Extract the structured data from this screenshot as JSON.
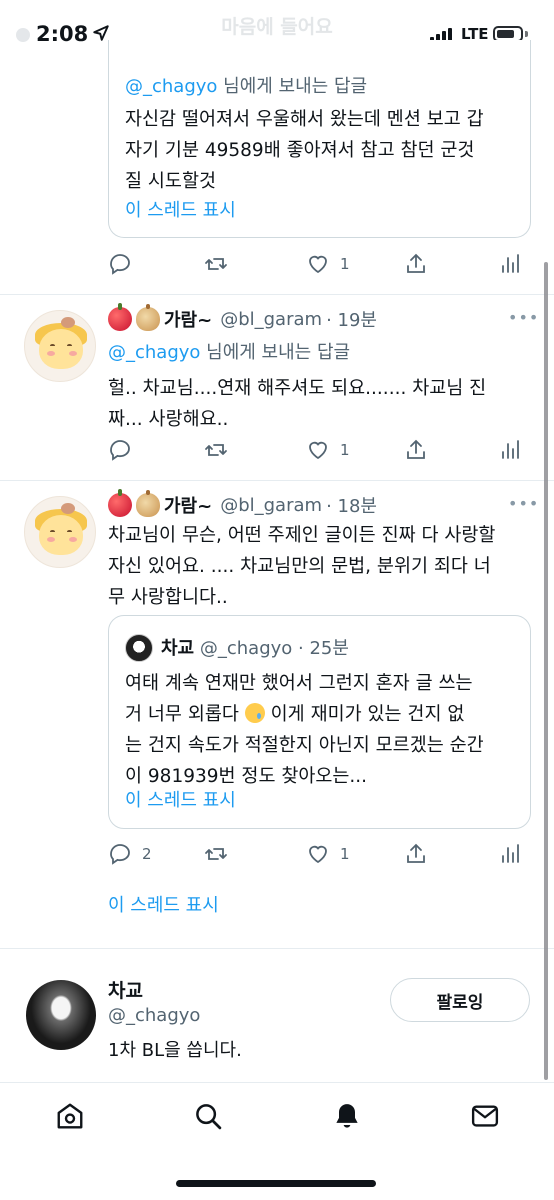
{
  "status_bar": {
    "time": "2:08",
    "network": "LTE",
    "ghost_title": "마음에 들어요",
    "ghost_subtitle": ""
  },
  "tweets": [
    {
      "reply_to_prefix": "@_chagyo",
      "reply_to_suffix": " 님에게 보내는 답글",
      "text_lines": [
        "자신감 떨어져서 우울해서 왔는데 멘션 보고 갑",
        "자기 기분 49589배 좋아져서 참고 참던 군것",
        "질 시도할것"
      ],
      "show_thread": "이 스레드 표시",
      "actions": {
        "reply": "",
        "retweet": "",
        "like": "1"
      }
    },
    {
      "display_name": "가람~",
      "handle": "@bl_garam",
      "time": "· 19분",
      "reply_to_prefix": "@_chagyo",
      "reply_to_suffix": " 님에게 보내는 답글",
      "text_lines": [
        "헐.. 차교님....연재 해주셔도 되요....... 차교님 진",
        "짜... 사랑해요.."
      ],
      "actions": {
        "reply": "",
        "retweet": "",
        "like": "1"
      }
    },
    {
      "display_name": "가람~",
      "handle": "@bl_garam",
      "time": "· 18분",
      "text_lines": [
        "차교님이 무슨, 어떤 주제인 글이든 진짜 다 사랑할",
        "자신 있어요. .... 차교님만의 문법, 분위기 죄다 너",
        "무 사랑합니다.."
      ],
      "quote": {
        "name": "차교",
        "handle": "@_chagyo",
        "time": "· 25분",
        "text_line1": "여태 계속 연재만 했어서 그런지 혼자 글 쓰는",
        "text_line2a": "거 너무 외롭다 ",
        "text_line2b": " 이게 재미가 있는 건지 없",
        "text_line3": "는 건지 속도가 적절한지 아닌지 모르겠는 순간",
        "text_line4": "이 981939번 정도 찾아오는...",
        "show_thread": "이 스레드 표시"
      },
      "actions": {
        "reply": "2",
        "retweet": "",
        "like": "1"
      },
      "show_thread": "이 스레드 표시"
    }
  ],
  "profile": {
    "name": "차교",
    "handle": "@_chagyo",
    "bio": "1차 BL을 씁니다.",
    "follow_label": "팔로잉"
  },
  "tabbar": {
    "items": [
      "home-icon",
      "search-icon",
      "notifications-icon",
      "messages-icon"
    ],
    "active": "notifications-icon"
  },
  "colors": {
    "accent": "#1d9bf0",
    "text": "#0f1419",
    "secondary": "#536471",
    "border": "#cfd9de"
  }
}
